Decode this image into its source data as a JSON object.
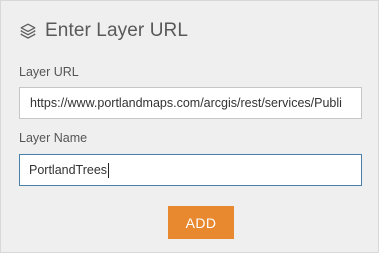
{
  "dialog": {
    "title": "Enter Layer URL",
    "icon": "layers-icon"
  },
  "fields": {
    "url": {
      "label": "Layer URL",
      "value": "https://www.portlandmaps.com/arcgis/rest/services/Publi"
    },
    "name": {
      "label": "Layer Name",
      "value": "PortlandTrees"
    }
  },
  "actions": {
    "add_label": "ADD"
  },
  "colors": {
    "panel_background": "#efefef",
    "button": "#e8882f",
    "focus_border": "#4a7fa8"
  }
}
